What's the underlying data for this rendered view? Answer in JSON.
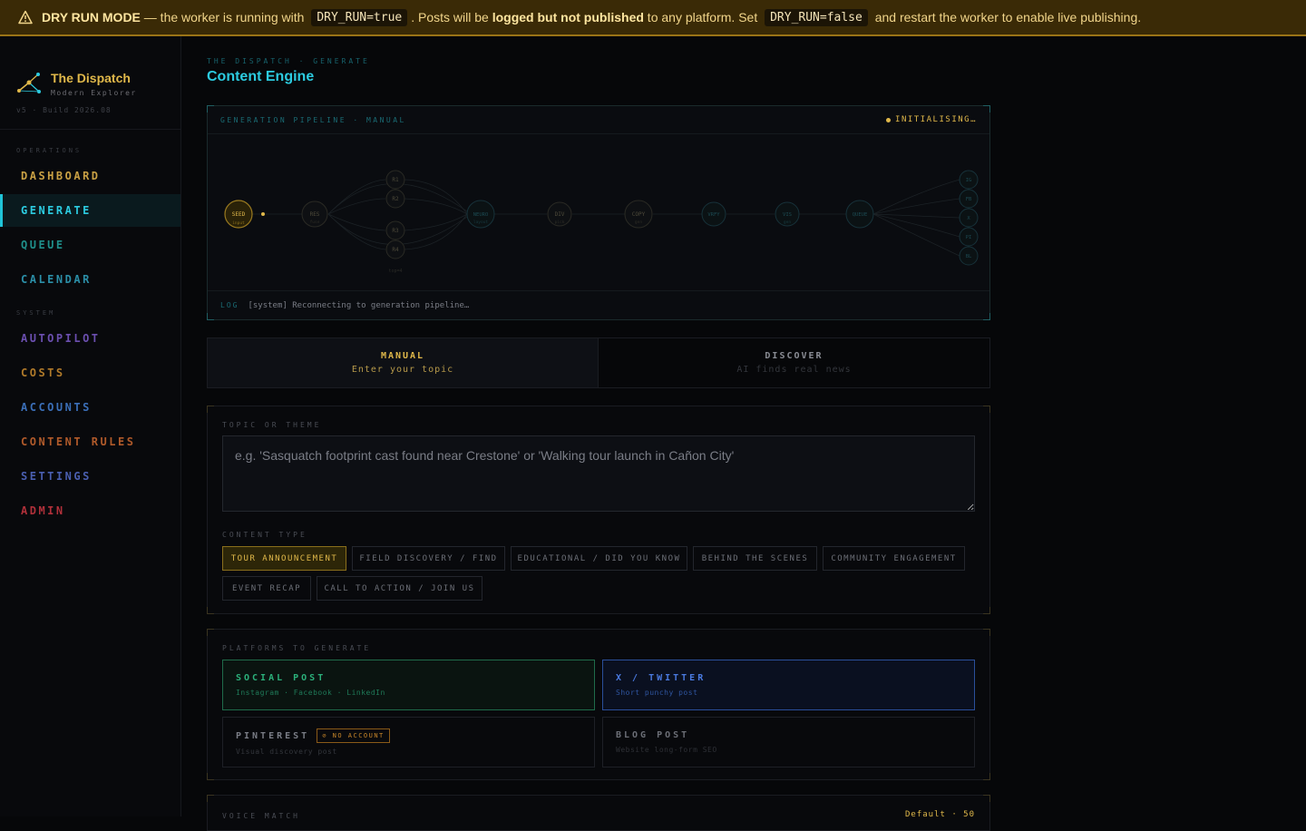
{
  "banner": {
    "title": "DRY RUN MODE",
    "part1": " — the worker is running with ",
    "code1": "DRY_RUN=true",
    "part2": ". Posts will be ",
    "strong": "logged but not published",
    "part3": " to any platform. Set ",
    "code2": "DRY_RUN=false",
    "part4": " and restart the worker to enable live publishing.",
    "color": "#f1d58a"
  },
  "brand": {
    "name": "The Dispatch",
    "subtitle": "Modern Explorer",
    "build": "v5 · Build 2026.08"
  },
  "sidebar": {
    "section_ops": "OPERATIONS",
    "section_system": "SYSTEM",
    "items": [
      {
        "label": "DASHBOARD",
        "color": "#c9a044"
      },
      {
        "label": "GENERATE",
        "color": "#2ccbe0"
      },
      {
        "label": "QUEUE",
        "color": "#1f8f8a"
      },
      {
        "label": "CALENDAR",
        "color": "#2b8fa8"
      },
      {
        "label": "AUTOPILOT",
        "color": "#6b4fb0"
      },
      {
        "label": "COSTS",
        "color": "#b07a2a"
      },
      {
        "label": "ACCOUNTS",
        "color": "#3b6fb8"
      },
      {
        "label": "CONTENT RULES",
        "color": "#b05a2a"
      },
      {
        "label": "SETTINGS",
        "color": "#4a5fb0"
      },
      {
        "label": "ADMIN",
        "color": "#b0303a"
      }
    ]
  },
  "header": {
    "breadcrumb": "THE DISPATCH · GENERATE",
    "title": "Content Engine"
  },
  "pipeline": {
    "title": "GENERATION PIPELINE · MANUAL",
    "status": "INITIALISING…",
    "log_label": "LOG",
    "log_text": "[system] Reconnecting to generation pipeline…",
    "nodes": {
      "seed": "SEED",
      "seed_sub": "input",
      "res": "RES",
      "res_sub": "fuse",
      "r1": "R1",
      "r2": "R2",
      "r3": "R3",
      "r4": "R4",
      "r_sub": "top=4",
      "neuro": "NEURO",
      "neuro_sub": "layout",
      "div": "DIV",
      "div_sub": "pick",
      "copy": "COPY",
      "copy_sub": "gen",
      "vrfy": "VRFY",
      "vis": "VIS",
      "vis_sub": "gen",
      "queue": "QUEUE",
      "ig": "IG",
      "fb": "FB",
      "x": "X",
      "pi": "PI",
      "bl": "BL"
    }
  },
  "mode_tabs": [
    {
      "label": "MANUAL",
      "sub": "Enter your topic",
      "active": true
    },
    {
      "label": "DISCOVER",
      "sub": "AI finds real news",
      "active": false
    }
  ],
  "form": {
    "topic_label": "TOPIC OR THEME",
    "topic_placeholder": "e.g. 'Sasquatch footprint cast found near Crestone' or 'Walking tour launch in Cañon City'",
    "type_label": "CONTENT TYPE",
    "types": [
      "TOUR ANNOUNCEMENT",
      "FIELD DISCOVERY / FIND",
      "EDUCATIONAL / DID YOU KNOW",
      "BEHIND THE SCENES",
      "COMMUNITY ENGAGEMENT",
      "EVENT RECAP",
      "CALL TO ACTION / JOIN US"
    ],
    "selected_type": "TOUR ANNOUNCEMENT"
  },
  "platforms": {
    "label": "PLATFORMS TO GENERATE",
    "items": [
      {
        "name": "SOCIAL POST",
        "sub": "Instagram · Facebook · LinkedIn",
        "selected": true
      },
      {
        "name": "X / TWITTER",
        "sub": "Short punchy post",
        "selected": true
      },
      {
        "name": "PINTEREST",
        "sub": "Visual discovery post",
        "badge": "⊘ NO ACCOUNT",
        "selected": false
      },
      {
        "name": "BLOG POST",
        "sub": "Website long-form SEO",
        "selected": false
      }
    ]
  },
  "voice": {
    "label": "VOICE MATCH",
    "value": "Default · 50"
  },
  "colors": {
    "accent_cyan": "#2ccbe0",
    "accent_gold": "#e0b84a",
    "bg": "#060709"
  }
}
